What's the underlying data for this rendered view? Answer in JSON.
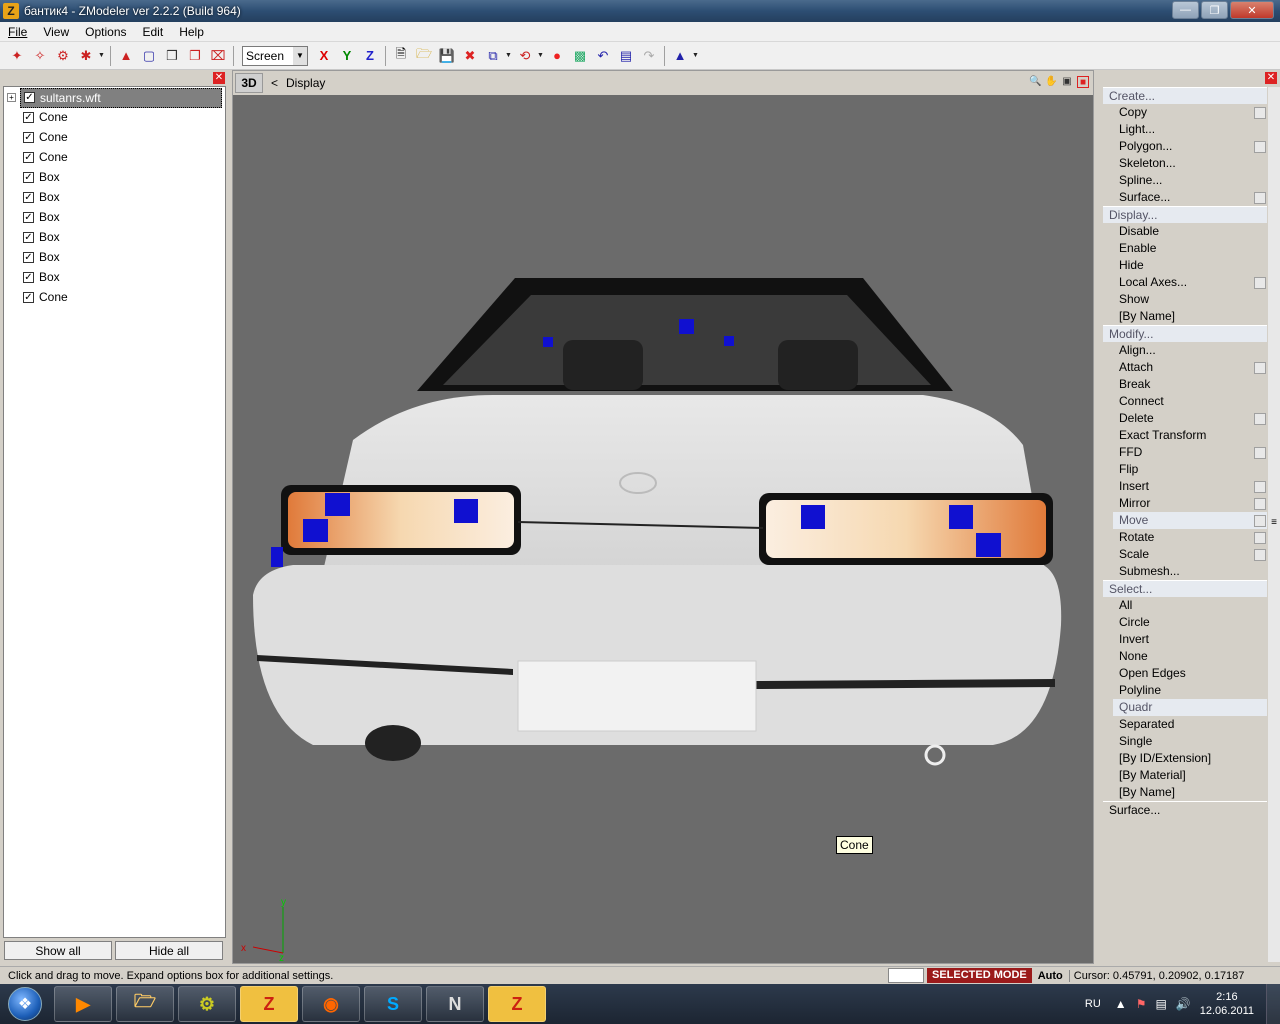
{
  "window": {
    "title": "бантик4 - ZModeler ver 2.2.2 (Build 964)",
    "app_icon": "Z"
  },
  "menu": [
    "File",
    "View",
    "Options",
    "Edit",
    "Help"
  ],
  "toolbar": {
    "coord_mode": "Screen",
    "axis_x": "X",
    "axis_y": "Y",
    "axis_z": "Z"
  },
  "tree": {
    "root": "sultanrs.wft",
    "items": [
      "Cone",
      "Cone",
      "Cone",
      "Box",
      "Box",
      "Box",
      "Box",
      "Box",
      "Box",
      "Cone"
    ]
  },
  "left_buttons": {
    "show_all": "Show all",
    "hide_all": "Hide all"
  },
  "viewport": {
    "view_label": "3D",
    "back_arrow": "<",
    "breadcrumb": "Display",
    "tooltip": "Cone"
  },
  "right_panel": {
    "create": {
      "label": "Create...",
      "items": [
        "Copy",
        "Light...",
        "Polygon...",
        "Skeleton...",
        "Spline...",
        "Surface..."
      ]
    },
    "display": {
      "label": "Display...",
      "items": [
        "Disable",
        "Enable",
        "Hide",
        "Local Axes...",
        "Show",
        "[By Name]"
      ]
    },
    "modify": {
      "label": "Modify...",
      "items": [
        "Align...",
        "Attach",
        "Break",
        "Connect",
        "Delete",
        "Exact Transform",
        "FFD",
        "Flip",
        "Insert",
        "Mirror",
        "Move",
        "Rotate",
        "Scale",
        "Submesh..."
      ]
    },
    "select": {
      "label": "Select...",
      "items": [
        "All",
        "Circle",
        "Invert",
        "None",
        "Open Edges",
        "Polyline",
        "Quadr",
        "Separated",
        "Single",
        "[By ID/Extension]",
        "[By Material]",
        "[By Name]"
      ]
    },
    "surface": {
      "label": "Surface..."
    }
  },
  "status": {
    "message": "Click and drag to move. Expand options box for additional settings.",
    "mode": "SELECTED MODE",
    "auto": "Auto",
    "cursor": "Cursor: 0.45791, 0.20902, 0.17187"
  },
  "taskbar": {
    "apps": [
      "media-player",
      "file-explorer",
      "tool-app",
      "zmodeler",
      "firefox",
      "skype",
      "notepad-app",
      "zmodeler-2"
    ],
    "lang": "RU",
    "time": "2:16",
    "date": "12.06.2011"
  }
}
